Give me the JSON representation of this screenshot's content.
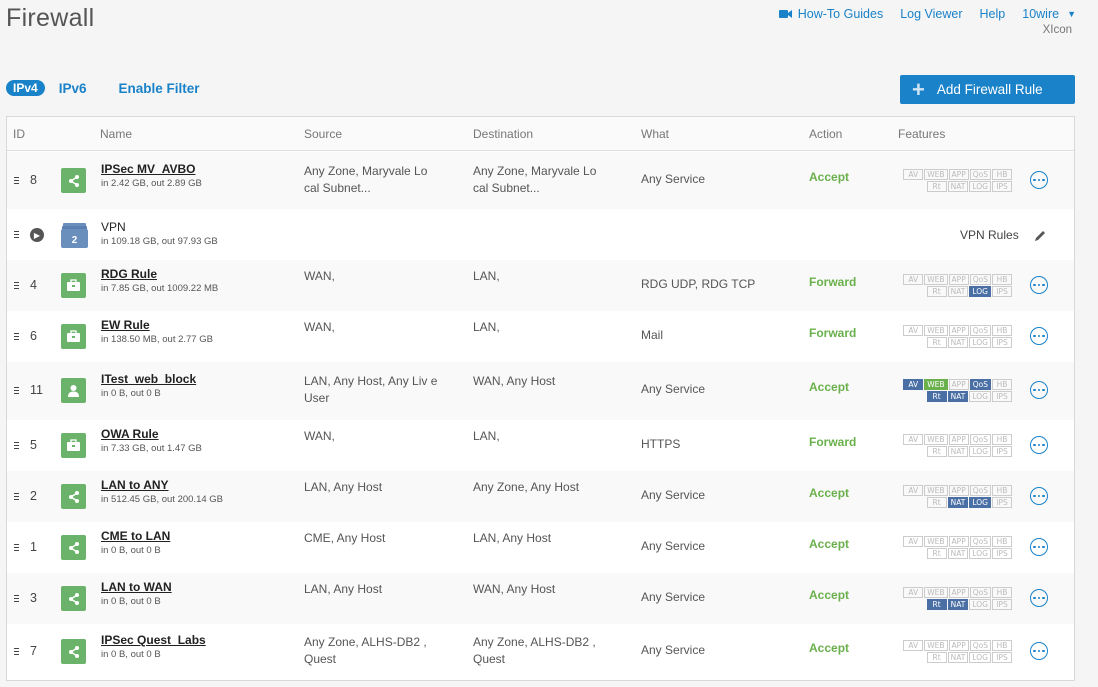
{
  "page": {
    "title": "Firewall"
  },
  "topnav": {
    "howto": "How-To Guides",
    "logviewer": "Log Viewer",
    "help": "Help",
    "user": "10wire",
    "user_sub": "XIcon"
  },
  "tabs": {
    "ipv4": "IPv4",
    "ipv6": "IPv6",
    "filter": "Enable Filter"
  },
  "add_button": "Add Firewall Rule",
  "columns": {
    "id": "ID",
    "name": "Name",
    "source": "Source",
    "destination": "Destination",
    "what": "What",
    "action": "Action",
    "features": "Features"
  },
  "feature_labels": [
    "AV",
    "WEB",
    "APP",
    "QoS",
    "HB",
    "Rt",
    "NAT",
    "LOG",
    "IPS"
  ],
  "rows": [
    {
      "id": "8",
      "name": "IPSec MV_AVBO",
      "traffic": "in 2.42 GB, out 2.89 GB",
      "source": "Any Zone, Maryvale Lo cal Subnet...",
      "destination": "Any Zone, Maryvale Lo cal Subnet...",
      "what": "Any Service",
      "action": "Accept",
      "icon": "share"
    },
    {
      "id": "",
      "name": "VPN",
      "traffic": "in 109.18 GB, out 97.93 GB",
      "vpn_count": "2",
      "vpn_rules": "VPN Rules"
    },
    {
      "id": "4",
      "name": "RDG Rule",
      "traffic": "in 7.85 GB, out 1009.22 MB",
      "source": "WAN,",
      "destination": "LAN,",
      "what": "RDG UDP, RDG TCP",
      "action": "Forward",
      "icon": "briefcase"
    },
    {
      "id": "6",
      "name": "EW Rule",
      "traffic": "in 138.50 MB, out 2.77 GB",
      "source": "WAN,",
      "destination": "LAN,",
      "what": "Mail",
      "action": "Forward",
      "icon": "briefcase"
    },
    {
      "id": "11",
      "name": "ITest_web_block",
      "traffic": "in 0 B, out 0 B",
      "source": "LAN, Any Host, Any Liv e User",
      "destination": "WAN, Any Host",
      "what": "Any Service",
      "action": "Accept",
      "icon": "user"
    },
    {
      "id": "5",
      "name": "OWA Rule",
      "traffic": "in 7.33 GB, out 1.47 GB",
      "source": "WAN,",
      "destination": "LAN,",
      "what": "HTTPS",
      "action": "Forward",
      "icon": "briefcase"
    },
    {
      "id": "2",
      "name": "LAN to ANY",
      "traffic": "in 512.45 GB, out 200.14 GB",
      "source": "LAN, Any Host",
      "destination": "Any Zone, Any Host",
      "what": "Any Service",
      "action": "Accept",
      "icon": "share"
    },
    {
      "id": "1",
      "name": "CME to LAN",
      "traffic": "in 0 B, out 0 B",
      "source": "CME, Any Host",
      "destination": "LAN, Any Host",
      "what": "Any Service",
      "action": "Accept",
      "icon": "share"
    },
    {
      "id": "3",
      "name": "LAN to WAN",
      "traffic": "in 0 B, out 0 B",
      "source": "LAN, Any Host",
      "destination": "WAN, Any Host",
      "what": "Any Service",
      "action": "Accept",
      "icon": "share"
    },
    {
      "id": "7",
      "name": "IPSec Quest_Labs",
      "traffic": "in 0 B, out 0 B",
      "source": "Any Zone, ALHS-DB2 , Quest",
      "destination": "Any Zone, ALHS-DB2 , Quest",
      "what": "Any Service",
      "action": "Accept",
      "icon": "share"
    }
  ],
  "colors": {
    "accent": "#1a82c9",
    "accept": "#6ab04c",
    "icon_green": "#6bb36b",
    "feature_on": "#4a6fa5"
  }
}
